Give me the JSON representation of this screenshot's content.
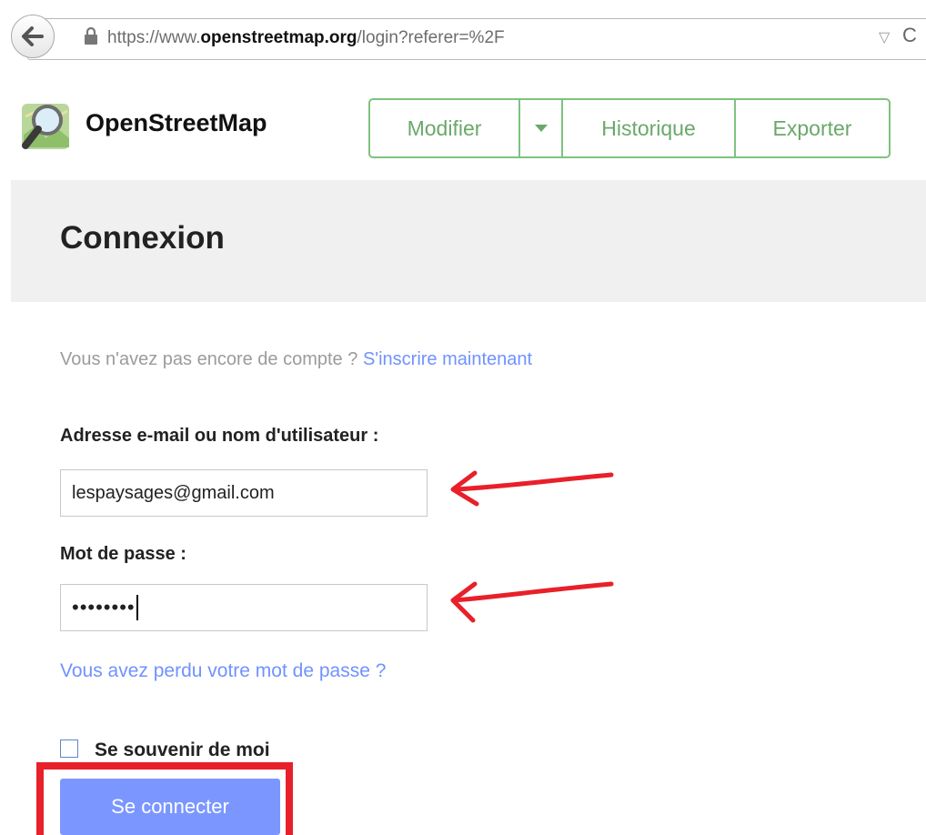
{
  "browser": {
    "url_prefix": "https://www.",
    "url_domain": "openstreetmap.org",
    "url_path": "/login?referer=%2F"
  },
  "site": {
    "name": "OpenStreetMap",
    "nav": {
      "modifier": "Modifier",
      "historique": "Historique",
      "exporter": "Exporter"
    }
  },
  "page": {
    "title": "Connexion"
  },
  "form": {
    "signup_text": "Vous n'avez pas encore de compte ?",
    "signup_link": "S'inscrire maintenant",
    "email_label": "Adresse e-mail ou nom d'utilisateur :",
    "email_value": "lespaysages@gmail.com",
    "password_label": "Mot de passe :",
    "password_value": "••••••••",
    "forgot_link": "Vous avez perdu votre mot de passe ?",
    "remember_label": "Se souvenir de moi",
    "remember_checked": false,
    "submit_label": "Se connecter"
  },
  "colors": {
    "accent_green": "#7ec27e",
    "link_blue": "#7092ff",
    "button_blue": "#7b97ff",
    "annotation_red": "#e8202a"
  }
}
